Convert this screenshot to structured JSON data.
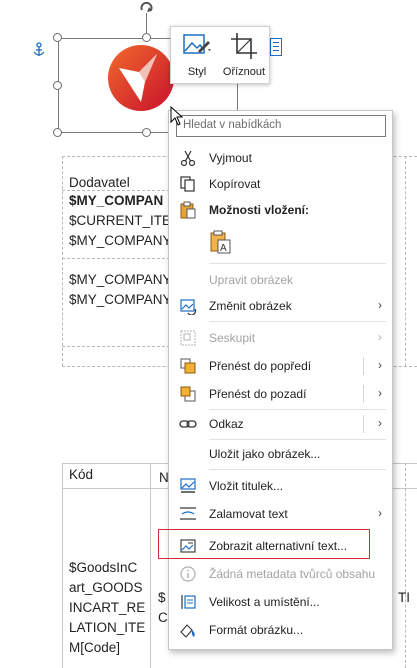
{
  "document": {
    "supplier_header": "Dodavatel",
    "my_company_bold": "$MY_COMPAN",
    "current_item": "$CURRENT_ITEM",
    "my_company_1": "$MY_COMPANY",
    "my_company_2": "$MY_COMPANY",
    "my_company_3": "$MY_COMPANY",
    "code_header": "Kód",
    "name_header_partial": "N",
    "goods_line_1": "$GoodsInC",
    "goods_line_2": "art_GOODS",
    "goods_line_3": "INCART_RE",
    "goods_line_4": "LATION_ITE",
    "goods_line_5": "M[Code]",
    "col2_partial_1": "$",
    "col2_partial_2": "C",
    "right_edge_partial": "TI"
  },
  "mini_toolbar": {
    "style_label": "Styl",
    "crop_label": "Oříznout"
  },
  "menu": {
    "search_placeholder": "Hledat v nabídkách",
    "cut": "Vyjmout",
    "copy": "Kopírovat",
    "paste_options": "Možnosti vložení:",
    "edit_picture": "Upravit obrázek",
    "change_picture": "Změnit obrázek",
    "group": "Seskupit",
    "bring_forward": "Přenést do popředí",
    "send_backward": "Přenést do pozadí",
    "link": "Odkaz",
    "save_as_picture": "Uložit jako obrázek...",
    "insert_caption": "Vložit titulek...",
    "wrap_text": "Zalamovat text",
    "view_alt_text": "Zobrazit alternativní text...",
    "no_creator_metadata": "Žádná metadata tvůrců obsahu",
    "size_position": "Velikost a umístění...",
    "format_picture": "Formát obrázku..."
  },
  "colors": {
    "highlight_border": "#d9262f",
    "logo_red": "#e8342a",
    "accent_blue": "#1b6ec2"
  }
}
